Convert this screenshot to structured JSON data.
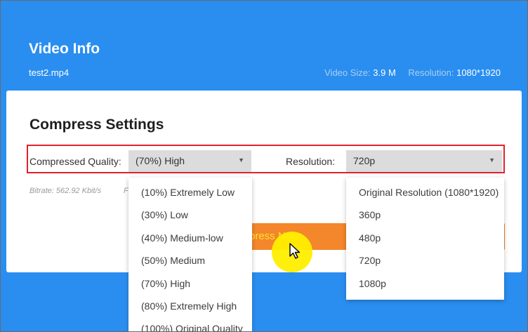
{
  "header": {
    "title": "Video Info",
    "filename": "test2.mp4",
    "size_label": "Video Size:",
    "size_value": "3.9 M",
    "resolution_label": "Resolution:",
    "resolution_value": "1080*1920"
  },
  "settings": {
    "title": "Compress Settings",
    "quality_label": "Compressed Quality:",
    "quality_value": "(70%) High",
    "resolution_label": "Resolution:",
    "resolution_value": "720p",
    "bitrate_text": "Bitrate: 562.92 Kbit/s",
    "bitrate_trunc": "F",
    "compress_button": "press Now"
  },
  "quality_options": [
    "(10%) Extremely Low",
    "(30%) Low",
    "(40%) Medium-low",
    "(50%) Medium",
    "(70%) High",
    "(80%) Extremely High",
    "(100%) Original Quality"
  ],
  "resolution_options": [
    "Original Resolution (1080*1920)",
    "360p",
    "480p",
    "720p",
    "1080p"
  ],
  "icons": {
    "dropdown_arrow": "▼",
    "cursor": "arrow-cursor-icon"
  },
  "colors": {
    "background": "#2a8ef0",
    "card": "#ffffff",
    "highlight_border": "#e0222b",
    "button": "#f4862c",
    "button_text": "#ffe32b",
    "cursor_halo": "#ffee00"
  }
}
